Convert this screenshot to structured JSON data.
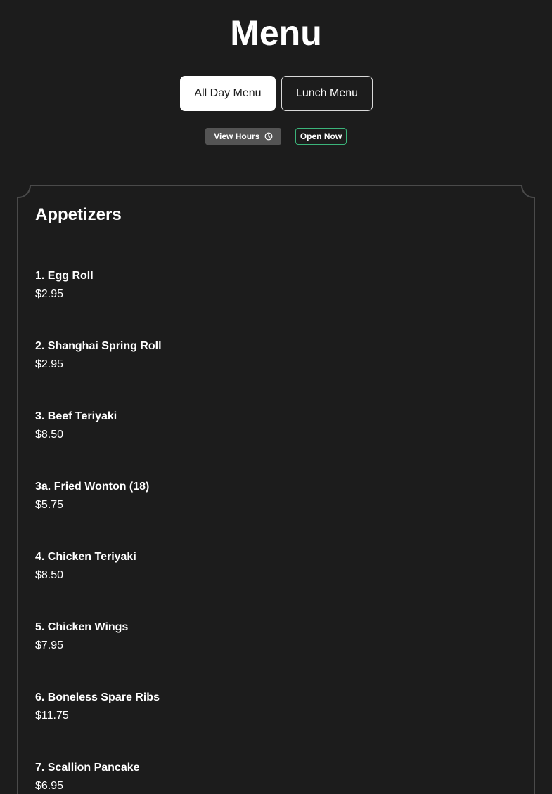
{
  "header": {
    "title": "Menu"
  },
  "tabs": [
    {
      "label": "All Day Menu",
      "active": true
    },
    {
      "label": "Lunch Menu",
      "active": false
    }
  ],
  "hours": {
    "view_hours_label": "View Hours",
    "icon": "clock-icon",
    "status": "Open Now"
  },
  "colors": {
    "background": "#1c1c1c",
    "status_border": "#3bb47a",
    "hours_button": "#545454"
  },
  "section": {
    "title": "Appetizers",
    "items": [
      {
        "name": "1. Egg Roll",
        "price": "$2.95"
      },
      {
        "name": "2. Shanghai Spring Roll",
        "price": "$2.95"
      },
      {
        "name": "3. Beef Teriyaki",
        "price": "$8.50"
      },
      {
        "name": "3a. Fried Wonton (18)",
        "price": "$5.75"
      },
      {
        "name": "4. Chicken Teriyaki",
        "price": "$8.50"
      },
      {
        "name": "5. Chicken Wings",
        "price": "$7.95"
      },
      {
        "name": "6. Boneless Spare Ribs",
        "price": "$11.75"
      },
      {
        "name": "7. Scallion Pancake",
        "price": "$6.95"
      }
    ]
  }
}
